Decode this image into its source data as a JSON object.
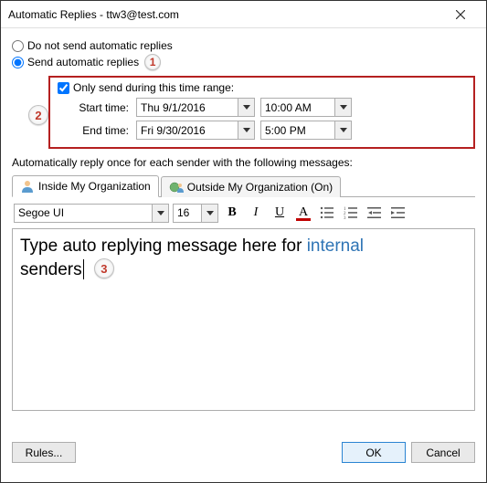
{
  "titlebar": {
    "title": "Automatic Replies - ttw3@test.com"
  },
  "radios": {
    "dont_send": "Do not send automatic replies",
    "send": "Send automatic replies"
  },
  "callouts": {
    "c1": "1",
    "c2": "2",
    "c3": "3"
  },
  "timebox": {
    "only_send": "Only send during this time range:",
    "start_label": "Start time:",
    "end_label": "End time:",
    "start_date": "Thu 9/1/2016",
    "start_time": "10:00 AM",
    "end_date": "Fri 9/30/2016",
    "end_time": "5:00 PM"
  },
  "instruction": "Automatically reply once for each sender with the following messages:",
  "tabs": {
    "inside": "Inside My Organization",
    "outside": "Outside My Organization (On)"
  },
  "toolbar": {
    "font": "Segoe UI",
    "size": "16",
    "bold": "B",
    "italic": "I",
    "underline": "U",
    "color": "A"
  },
  "editor": {
    "line1a": "Type auto replying message here for ",
    "line1b": "internal",
    "line2": "senders"
  },
  "footer": {
    "rules": "Rules...",
    "ok": "OK",
    "cancel": "Cancel"
  }
}
